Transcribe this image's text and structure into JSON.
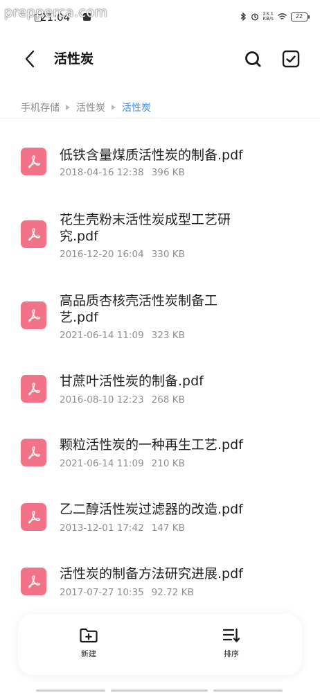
{
  "status_bar": {
    "watermark": "prepperca.com",
    "time": "21:04",
    "net_speed_value": "23.1",
    "net_speed_unit": "KB/s",
    "battery": "22"
  },
  "header": {
    "title": "活性炭"
  },
  "breadcrumb": {
    "items": [
      "手机存储",
      "活性炭",
      "活性炭"
    ]
  },
  "files": [
    {
      "name": "低铁含量煤质活性炭的制备.pdf",
      "date": "2018-04-16 12:38",
      "size": "396 KB"
    },
    {
      "name": "花生壳粉末活性炭成型工艺研究.pdf",
      "date": "2016-12-20 16:04",
      "size": "330 KB"
    },
    {
      "name": "高品质杏核壳活性炭制备工艺.pdf",
      "date": "2021-06-14 11:09",
      "size": "323 KB"
    },
    {
      "name": "甘蔗叶活性炭的制备.pdf",
      "date": "2016-08-10 12:23",
      "size": "268 KB"
    },
    {
      "name": "颗粒活性炭的一种再生工艺.pdf",
      "date": "2021-06-14 11:09",
      "size": "210 KB"
    },
    {
      "name": "乙二醇活性炭过滤器的改造.pdf",
      "date": "2013-12-01 17:42",
      "size": "147 KB"
    },
    {
      "name": "活性炭的制备方法研究进展.pdf",
      "date": "2017-07-27 10:35",
      "size": "92.72 KB"
    }
  ],
  "bottom_bar": {
    "new_label": "新建",
    "sort_label": "排序"
  },
  "colors": {
    "accent": "#3d8bf2",
    "pdf_icon": "#f27387"
  }
}
